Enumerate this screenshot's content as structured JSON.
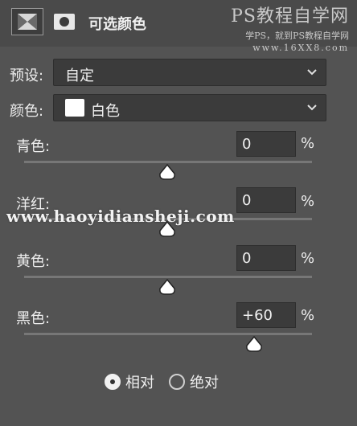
{
  "header": {
    "title": "可选颜色",
    "adjustment_icon": "adjustment-layer-icon",
    "mask_icon": "mask-icon"
  },
  "watermark": {
    "line1": "PS教程自学网",
    "line2": "学PS，就到PS教程自学网",
    "line3": "www.16XX8.com"
  },
  "preset": {
    "label": "预设:",
    "value": "自定"
  },
  "colors": {
    "label": "颜色:",
    "value": "白色",
    "swatch": "#ffffff"
  },
  "sliders": [
    {
      "label": "青色:",
      "value": "0",
      "unit": "%",
      "level": 0
    },
    {
      "label": "洋红:",
      "value": "0",
      "unit": "%",
      "level": 0
    },
    {
      "label": "黄色:",
      "value": "0",
      "unit": "%",
      "level": 0
    },
    {
      "label": "黑色:",
      "value": "+60",
      "unit": "%",
      "level": 60
    }
  ],
  "overlay_watermark": "www.haoyidiansheji.com",
  "method": {
    "relative_label": "相对",
    "absolute_label": "绝对",
    "selected": "relative"
  },
  "colors_ui": {
    "panel": "#535353",
    "field": "#3b3b3b",
    "track": "#777777"
  }
}
